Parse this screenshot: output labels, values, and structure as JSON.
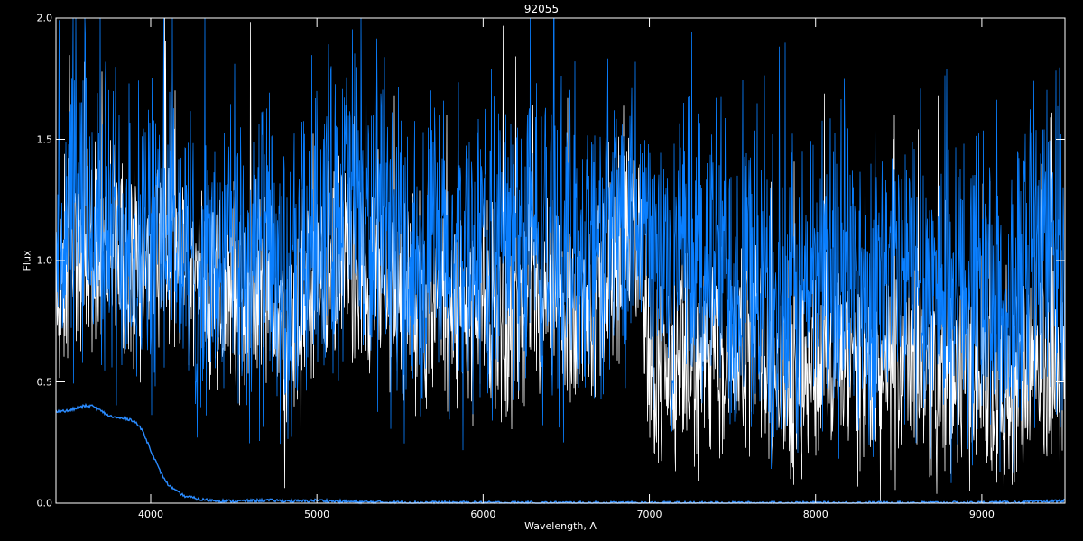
{
  "chart_data": {
    "type": "line",
    "title": "92055",
    "xlabel": "Wavelength, A",
    "ylabel": "Flux",
    "xlim": [
      3430,
      9500
    ],
    "ylim": [
      0.0,
      2.0
    ],
    "x_ticks": [
      4000,
      5000,
      6000,
      7000,
      8000,
      9000
    ],
    "x_tick_labels": [
      "4000",
      "5000",
      "6000",
      "7000",
      "8000",
      "9000"
    ],
    "y_ticks": [
      0.0,
      0.5,
      1.0,
      1.5,
      2.0
    ],
    "y_tick_labels": [
      "0.0",
      "0.5",
      "1.0",
      "1.5",
      "2.0"
    ],
    "grid": false,
    "background": "#000000",
    "axis_color": "#ffffff",
    "series": [
      {
        "color": "#ffffff",
        "points": [
          [
            3450,
            0.95
          ],
          [
            3600,
            1.05
          ],
          [
            3800,
            1.0
          ],
          [
            3950,
            0.95
          ],
          [
            4050,
            1.1
          ],
          [
            4100,
            1.15
          ],
          [
            4200,
            1.05
          ],
          [
            4300,
            0.85
          ],
          [
            4400,
            0.8
          ],
          [
            4500,
            0.9
          ],
          [
            4600,
            0.85
          ],
          [
            4700,
            0.88
          ],
          [
            4800,
            0.72
          ],
          [
            4850,
            0.68
          ],
          [
            4900,
            0.8
          ],
          [
            5000,
            0.9
          ],
          [
            5100,
            0.95
          ],
          [
            5200,
            1.0
          ],
          [
            5300,
            0.95
          ],
          [
            5400,
            0.9
          ],
          [
            5500,
            0.88
          ],
          [
            5600,
            0.85
          ],
          [
            5700,
            0.85
          ],
          [
            5800,
            0.78
          ],
          [
            5900,
            0.8
          ],
          [
            6000,
            0.82
          ],
          [
            6100,
            0.78
          ],
          [
            6200,
            0.75
          ],
          [
            6300,
            0.78
          ],
          [
            6400,
            0.8
          ],
          [
            6500,
            0.78
          ],
          [
            6600,
            0.82
          ],
          [
            6700,
            0.85
          ],
          [
            6800,
            0.95
          ],
          [
            6900,
            1.15
          ],
          [
            6950,
            1.05
          ],
          [
            7000,
            0.6
          ],
          [
            7100,
            0.55
          ],
          [
            7200,
            0.55
          ],
          [
            7300,
            0.56
          ],
          [
            7400,
            0.6
          ],
          [
            7500,
            0.62
          ],
          [
            7600,
            0.72
          ],
          [
            7700,
            0.65
          ],
          [
            7800,
            0.5
          ],
          [
            7900,
            0.5
          ],
          [
            8000,
            0.6
          ],
          [
            8100,
            0.55
          ],
          [
            8200,
            0.55
          ],
          [
            8300,
            0.52
          ],
          [
            8400,
            0.52
          ],
          [
            8500,
            0.55
          ],
          [
            8600,
            0.58
          ],
          [
            8700,
            0.55
          ],
          [
            8800,
            0.5
          ],
          [
            8900,
            0.55
          ],
          [
            9000,
            0.55
          ],
          [
            9100,
            0.48
          ],
          [
            9150,
            0.35
          ],
          [
            9200,
            0.45
          ],
          [
            9300,
            0.55
          ],
          [
            9400,
            0.55
          ],
          [
            9500,
            0.6
          ]
        ]
      },
      {
        "color": "#0a7fff",
        "points": [
          [
            3450,
            1.1
          ],
          [
            3500,
            1.15
          ],
          [
            3600,
            1.2
          ],
          [
            3700,
            1.15
          ],
          [
            3800,
            1.15
          ],
          [
            3900,
            1.1
          ],
          [
            4000,
            1.05
          ],
          [
            4050,
            1.1
          ],
          [
            4100,
            1.2
          ],
          [
            4150,
            1.05
          ],
          [
            4200,
            1.0
          ],
          [
            4300,
            0.95
          ],
          [
            4400,
            0.95
          ],
          [
            4500,
            1.05
          ],
          [
            4600,
            1.0
          ],
          [
            4700,
            1.05
          ],
          [
            4800,
            0.88
          ],
          [
            4850,
            0.78
          ],
          [
            4900,
            0.95
          ],
          [
            5000,
            1.2
          ],
          [
            5100,
            1.2
          ],
          [
            5200,
            1.3
          ],
          [
            5300,
            1.15
          ],
          [
            5400,
            1.05
          ],
          [
            5500,
            1.05
          ],
          [
            5600,
            1.0
          ],
          [
            5700,
            1.05
          ],
          [
            5800,
            0.95
          ],
          [
            5900,
            1.05
          ],
          [
            6000,
            1.1
          ],
          [
            6100,
            1.05
          ],
          [
            6200,
            1.1
          ],
          [
            6300,
            1.1
          ],
          [
            6400,
            1.05
          ],
          [
            6500,
            1.05
          ],
          [
            6600,
            1.1
          ],
          [
            6700,
            1.05
          ],
          [
            6800,
            1.15
          ],
          [
            6900,
            1.3
          ],
          [
            6950,
            1.25
          ],
          [
            7000,
            1.05
          ],
          [
            7100,
            0.95
          ],
          [
            7200,
            1.0
          ],
          [
            7300,
            1.0
          ],
          [
            7400,
            1.05
          ],
          [
            7500,
            0.95
          ],
          [
            7600,
            0.98
          ],
          [
            7700,
            0.85
          ],
          [
            7800,
            0.75
          ],
          [
            7900,
            0.8
          ],
          [
            8000,
            1.0
          ],
          [
            8100,
            0.95
          ],
          [
            8200,
            0.95
          ],
          [
            8300,
            0.9
          ],
          [
            8400,
            0.92
          ],
          [
            8500,
            0.92
          ],
          [
            8600,
            0.95
          ],
          [
            8700,
            0.9
          ],
          [
            8800,
            0.88
          ],
          [
            8900,
            0.9
          ],
          [
            9000,
            0.92
          ],
          [
            9100,
            0.85
          ],
          [
            9150,
            0.65
          ],
          [
            9200,
            0.85
          ],
          [
            9300,
            1.0
          ],
          [
            9400,
            1.05
          ],
          [
            9500,
            1.05
          ]
        ]
      },
      {
        "color": "#2a8bff",
        "points": [
          [
            3450,
            0.38
          ],
          [
            3500,
            0.38
          ],
          [
            3550,
            0.39
          ],
          [
            3600,
            0.4
          ],
          [
            3650,
            0.4
          ],
          [
            3700,
            0.38
          ],
          [
            3750,
            0.36
          ],
          [
            3800,
            0.35
          ],
          [
            3850,
            0.35
          ],
          [
            3900,
            0.34
          ],
          [
            3950,
            0.3
          ],
          [
            4000,
            0.22
          ],
          [
            4050,
            0.14
          ],
          [
            4100,
            0.08
          ],
          [
            4150,
            0.05
          ],
          [
            4200,
            0.03
          ],
          [
            4300,
            0.015
          ],
          [
            4400,
            0.01
          ],
          [
            4500,
            0.008
          ],
          [
            4600,
            0.01
          ],
          [
            4700,
            0.012
          ],
          [
            4800,
            0.01
          ],
          [
            4900,
            0.008
          ],
          [
            5000,
            0.012
          ],
          [
            5100,
            0.008
          ],
          [
            5200,
            0.006
          ],
          [
            5400,
            0.004
          ],
          [
            5600,
            0.003
          ],
          [
            6000,
            0.002
          ],
          [
            7000,
            0.001
          ],
          [
            8000,
            0.001
          ],
          [
            9000,
            0.002
          ],
          [
            9300,
            0.005
          ],
          [
            9500,
            0.01
          ]
        ]
      }
    ]
  }
}
